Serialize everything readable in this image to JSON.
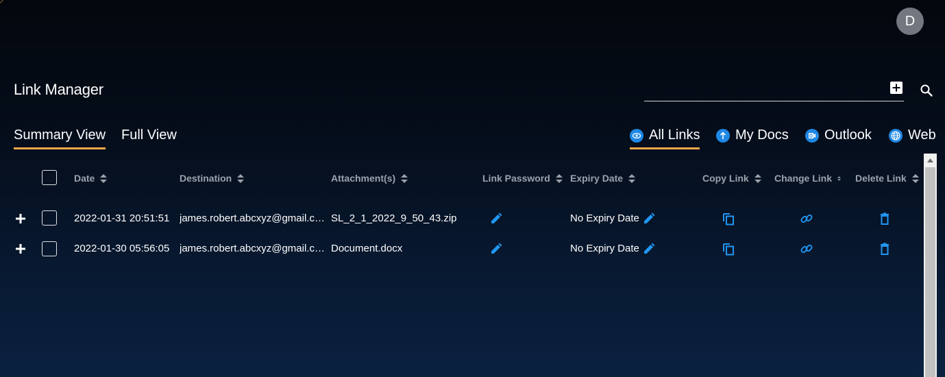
{
  "header": {
    "avatar_initial": "D"
  },
  "page": {
    "title": "Link Manager"
  },
  "search": {
    "value": "",
    "placeholder": ""
  },
  "views": {
    "summary_label": "Summary View",
    "full_label": "Full View",
    "active": "Summary View"
  },
  "filters": {
    "all_label": "All Links",
    "docs_label": "My Docs",
    "outlook_label": "Outlook",
    "web_label": "Web",
    "active": "All Links"
  },
  "table": {
    "columns": {
      "date": "Date",
      "destination": "Destination",
      "attachments": "Attachment(s)",
      "link_password": "Link Password",
      "expiry_date": "Expiry Date",
      "copy_link": "Copy Link",
      "change_link": "Change Link",
      "delete_link": "Delete Link"
    },
    "rows": [
      {
        "date": "2022-01-31 20:51:51",
        "destination": "james.robert.abcxyz@gmail.c…",
        "attachment": "SL_2_1_2022_9_50_43.zip",
        "expiry": "No Expiry Date"
      },
      {
        "date": "2022-01-30 05:56:05",
        "destination": "james.robert.abcxyz@gmail.c…",
        "attachment": "Document.docx",
        "expiry": "No Expiry Date"
      }
    ]
  },
  "colors": {
    "accent_underline": "#f0a94a",
    "icon_blue": "#2196f3",
    "header_text": "#9aa3ad"
  },
  "icons": {
    "add": "add-box-icon",
    "search": "search-icon",
    "all_links": "eye-icon",
    "my_docs": "upload-icon",
    "outlook": "outlook-icon",
    "web": "globe-icon",
    "password": "pencil-icon",
    "expiry": "pencil-icon",
    "copy": "copy-icon",
    "change": "link-icon",
    "delete": "trash-icon",
    "expand": "plus-icon"
  }
}
